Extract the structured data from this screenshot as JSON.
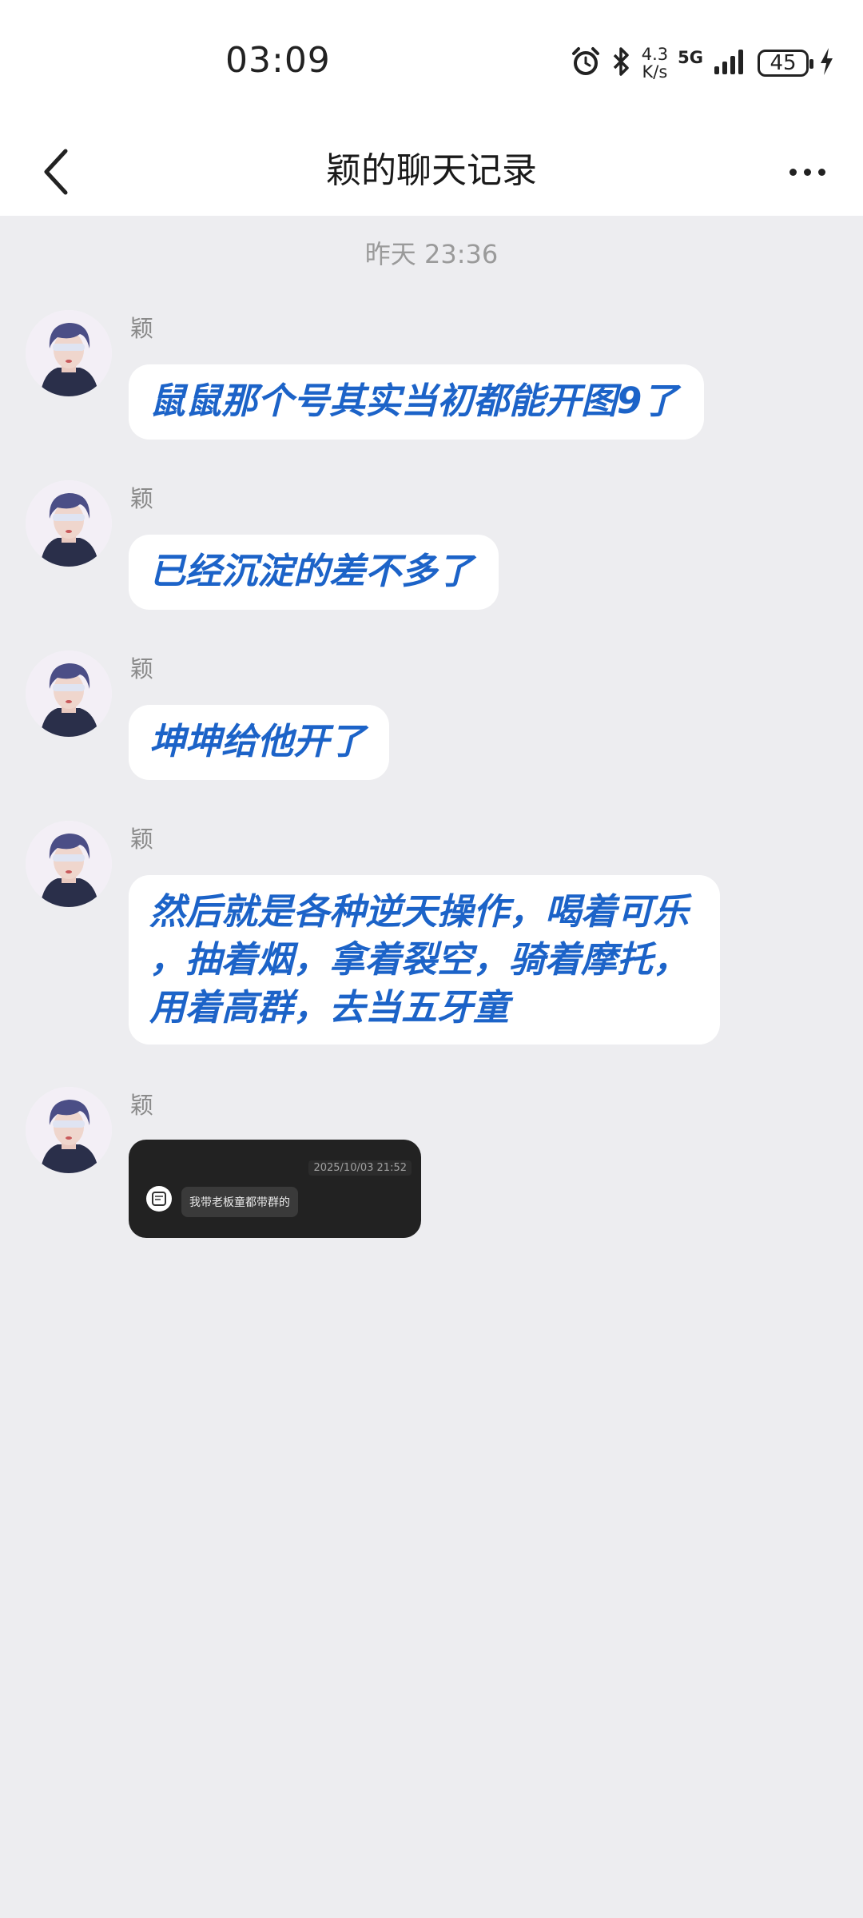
{
  "status_bar": {
    "time": "03:09",
    "speed_value": "4.3",
    "speed_unit": "K/s",
    "network": "5G",
    "battery": "45",
    "icons": [
      "alarm-icon",
      "bluetooth-icon",
      "signal-icon",
      "battery-icon",
      "charging-icon"
    ]
  },
  "nav": {
    "title": "颖的聊天记录",
    "back_icon": "chevron-left-icon",
    "more_icon": "more-dots-icon"
  },
  "timestamp": "昨天 23:36",
  "messages": [
    {
      "sender": "颖",
      "text": "鼠鼠那个号其实当初都能开图9了"
    },
    {
      "sender": "颖",
      "text": "已经沉淀的差不多了"
    },
    {
      "sender": "颖",
      "text": "坤坤给他开了"
    },
    {
      "sender": "颖",
      "lines": [
        "然后就是各种逆天操作，喝着可乐",
        "，抽着烟，拿着裂空，骑着摩托，",
        "用着高群，去当五牙童"
      ]
    },
    {
      "sender": "颖",
      "forward": {
        "date": "2025/10/03 21:52",
        "text": "我带老板童都带群的"
      }
    }
  ],
  "colors": {
    "accent_text": "#1c63c8",
    "background": "#ededf0",
    "card_dark": "#222222"
  }
}
